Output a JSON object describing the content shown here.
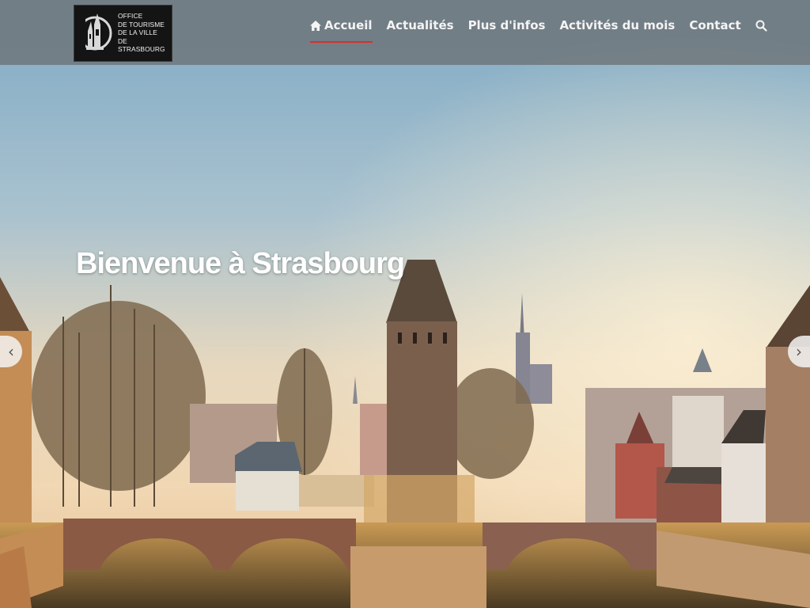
{
  "logo": {
    "lines": [
      "OFFICE",
      "DE TOURISME",
      "DE LA VILLE",
      "DE",
      "STRASBOURG"
    ]
  },
  "nav": {
    "items": [
      {
        "label": "Accueil",
        "icon": "home-icon",
        "active": true
      },
      {
        "label": "Actualités"
      },
      {
        "label": "Plus d'infos"
      },
      {
        "label": "Activités du mois"
      },
      {
        "label": "Contact"
      }
    ],
    "search_icon": "search-icon"
  },
  "hero": {
    "title": "Bienvenue à Strasbourg",
    "prev_arrow": "‹",
    "next_arrow": "›"
  },
  "colors": {
    "header_bg": "#6e7478",
    "active_underline": "#d9302b",
    "text": "#ffffff"
  }
}
